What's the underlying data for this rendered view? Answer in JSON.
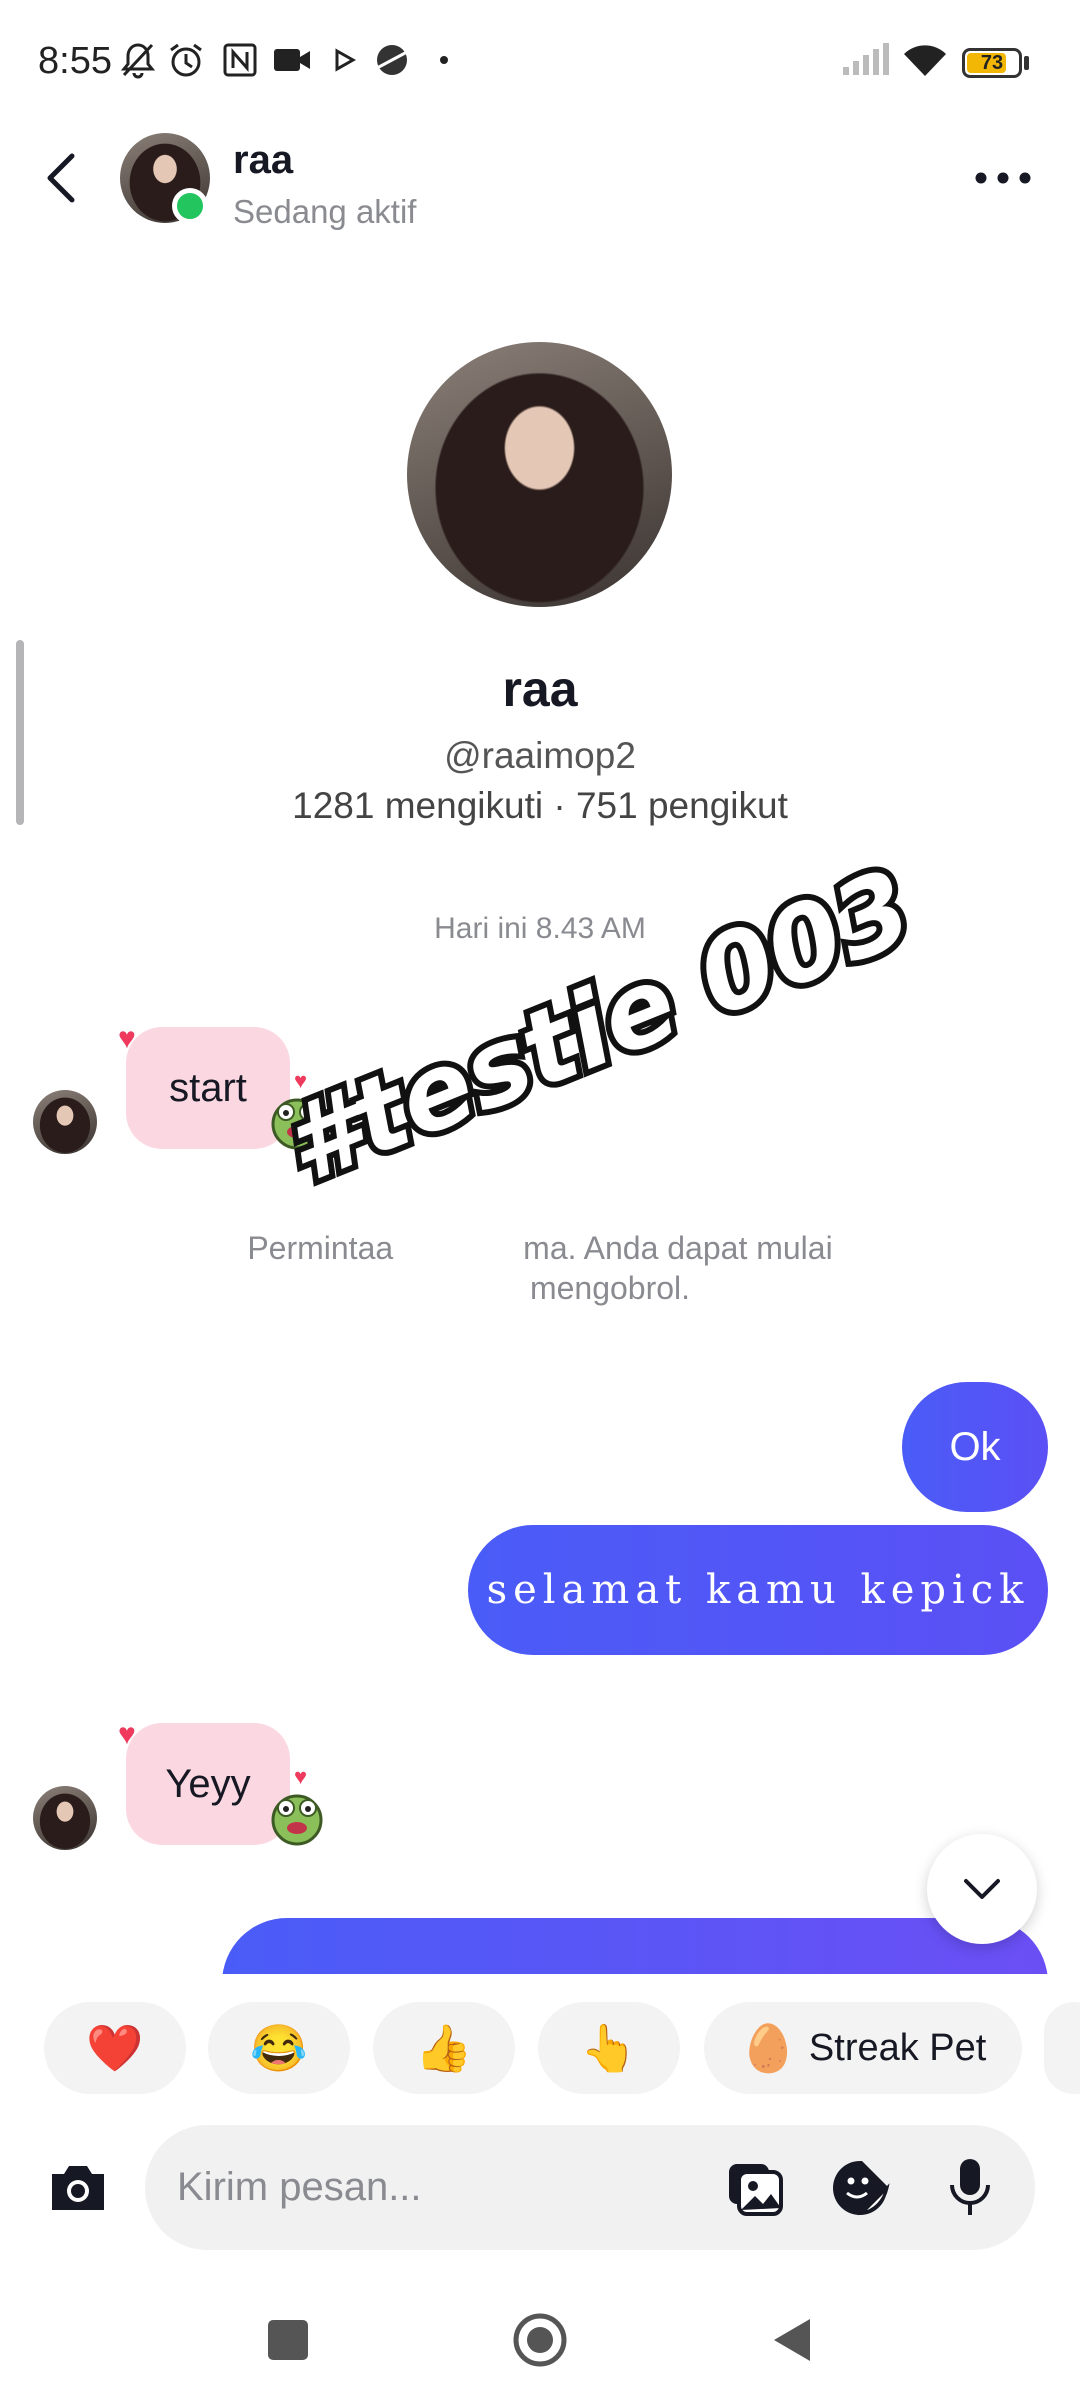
{
  "status_bar": {
    "time": "8:55",
    "battery": "73",
    "battery_level": 0.73,
    "icons": [
      "mute-bell-icon",
      "alarm-icon",
      "nfc-icon",
      "video-camera-icon",
      "play-icon",
      "planet-icon",
      "dot-icon",
      "signal-icon",
      "wifi-icon",
      "battery-icon"
    ]
  },
  "header": {
    "name": "raa",
    "status": "Sedang aktif"
  },
  "profile": {
    "name": "raa",
    "handle": "@raaimop2",
    "stats": "1281 mengikuti · 751 pengikut"
  },
  "chat": {
    "date_separator": "Hari ini 8.43 AM",
    "messages": [
      {
        "from": "them",
        "text": "start"
      },
      {
        "from": "me",
        "text": "Ok"
      },
      {
        "from": "me",
        "text": "selamat kamu kepick"
      },
      {
        "from": "them",
        "text": "Yeyy"
      }
    ],
    "notice": "Permintaan pesan diterima. Anda dapat mulai mengobrol.",
    "notice_visible_line1_left": "Permintaa",
    "notice_visible_line1_right": "ma. Anda dapat mulai",
    "notice_visible_line2": "mengobrol."
  },
  "watermark": "#testie 003",
  "quick_reactions": [
    {
      "icon": "heart-emoji",
      "glyph": "❤️"
    },
    {
      "icon": "laughing-emoji",
      "glyph": "😂"
    },
    {
      "icon": "thumbs-up-emoji",
      "glyph": "👍"
    },
    {
      "icon": "pointing-hand-emoji",
      "glyph": "👆"
    },
    {
      "icon": "egg-emoji",
      "glyph": "🥚",
      "label": "Streak Pet"
    }
  ],
  "composer": {
    "placeholder": "Kirim pesan..."
  },
  "colors": {
    "accent": "#4a5cf7",
    "incoming_bubble": "#fbd7e2",
    "online": "#22c55e"
  }
}
